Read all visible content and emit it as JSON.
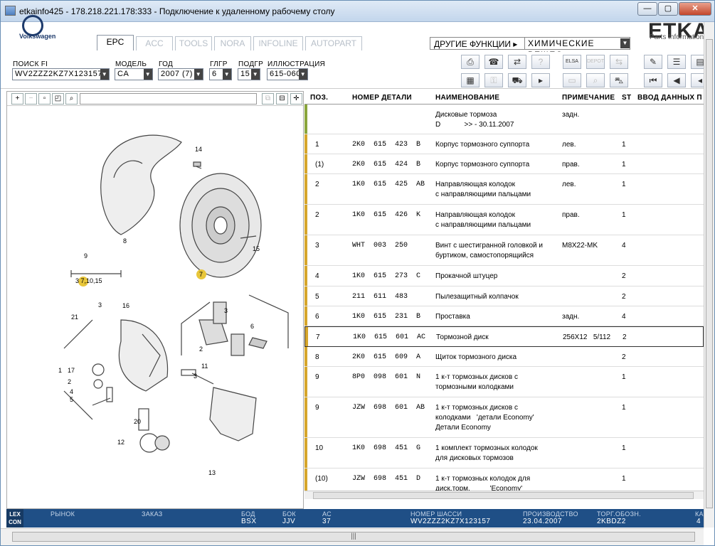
{
  "window": {
    "title": "etkainfo425 - 178.218.221.178:333 - Подключение к удаленному рабочему столу"
  },
  "brand": {
    "vw": "Volkswagen",
    "etka": "ETKA",
    "etka_sub": "Parts Information"
  },
  "tabs": [
    "EPC",
    "ACC",
    "TOOLS",
    "NORA",
    "INFOLINE",
    "AUTOPART"
  ],
  "other_functions": {
    "label": "ДРУГИЕ ФУНКЦИИ ▸",
    "value": "ХИМИЧЕСКИЕ ВЕЩЕС"
  },
  "filters": {
    "fi_label": "ПОИСК FI",
    "fi_value": "WV2ZZZ2KZ7X123157",
    "model_label": "МОДЕЛЬ",
    "model_value": "CA",
    "year_label": "ГОД",
    "year_value": "2007 (7)",
    "grp_label": "ГЛГР",
    "grp_value": "6",
    "sub_label": "ПОДГР",
    "sub_value": "15",
    "ill_label": "ИЛЛЮСТРАЦИЯ",
    "ill_value": "615-060"
  },
  "toolbar_icons": {
    "elsa": "ELSA",
    "depot": "DEPOT"
  },
  "table": {
    "headers": {
      "pos": "ПОЗ.",
      "pn": "НОМЕР ДЕТАЛИ",
      "name": "НАИМЕНОВАНИЕ",
      "note": "ПРИМЕЧАНИЕ",
      "st": "ST",
      "input": "ВВОД ДАННЫХ П"
    },
    "rows": [
      {
        "pos": "",
        "pn": "",
        "name": "Дисковые тормоза\nD            >> - 30.11.2007",
        "note": "задн.",
        "st": ""
      },
      {
        "pos": "1",
        "pn": "2K0  615  423  B",
        "name": "Корпус тормозного суппорта",
        "note": "лев.",
        "st": "1"
      },
      {
        "pos": "(1)",
        "pn": "2K0  615  424  B",
        "name": "Корпус тормозного суппорта",
        "note": "прав.",
        "st": "1"
      },
      {
        "pos": "2",
        "pn": "1K0  615  425  AB",
        "name": "Направляющая колодок\nс направляющими пальцами",
        "note": "лев.",
        "st": "1"
      },
      {
        "pos": "2",
        "pn": "1K0  615  426  K",
        "name": "Направляющая колодок\nс направляющими пальцами",
        "note": "прав.",
        "st": "1"
      },
      {
        "pos": "3",
        "pn": "WHT  003  250",
        "name": "Винт с шестигранной головкой и\nбуртиком, самостопорящийся",
        "note": "M8X22-MK",
        "st": "4"
      },
      {
        "pos": "4",
        "pn": "1K0  615  273  C",
        "name": "Прокачной штуцер",
        "note": "",
        "st": "2"
      },
      {
        "pos": "5",
        "pn": "211  611  483",
        "name": "Пылезащитный колпачок",
        "note": "",
        "st": "2"
      },
      {
        "pos": "6",
        "pn": "1K0  615  231  B",
        "name": "Проставка",
        "note": "задн.",
        "st": "4"
      },
      {
        "pos": "7",
        "pn": "1K0  615  601  AC",
        "name": "Тормозной диск",
        "note": "256X12   5/112",
        "st": "2"
      },
      {
        "pos": "8",
        "pn": "2K0  615  609  A",
        "name": "Щиток тормозного диска",
        "note": "",
        "st": "2"
      },
      {
        "pos": "9",
        "pn": "8P0  098  601  N",
        "name": "1 к-т тормозных дисков с\nтормозными колодками",
        "note": "",
        "st": "1"
      },
      {
        "pos": "9",
        "pn": "JZW  698  601  AB",
        "name": "1 к-т тормозных дисков с\nколодками   'детали Economy'\nДетали Economy",
        "note": "",
        "st": "1"
      },
      {
        "pos": "10",
        "pn": "1K0  698  451  G",
        "name": "1 комплект тормозных колодок\nдля дисковых тормозов",
        "note": "",
        "st": "1"
      },
      {
        "pos": "(10)",
        "pn": "JZW  698  451  D",
        "name": "1 к-т тормозных колодок для\nдиск.торм.          'Economy'",
        "note": "",
        "st": "1"
      }
    ]
  },
  "illustration": {
    "callouts": [
      "14",
      "8",
      "15",
      "7",
      "9",
      "3 7,10,15",
      "3",
      "16",
      "21",
      "1",
      "17",
      "2",
      "4",
      "5",
      "20",
      "12",
      "6",
      "3",
      "2",
      "3",
      "11",
      "13"
    ]
  },
  "status": {
    "lex": "LEX\nCON",
    "market_k": "РЫНОК",
    "market_v": "",
    "order_k": "ЗАКАЗ",
    "order_v": "",
    "bod_k": "БОД",
    "bod_v": "BSX",
    "bok_k": "БОК",
    "bok_v": "JJV",
    "ac_k": "АС",
    "ac_v": "37",
    "chassis_k": "НОМЕР ШАССИ",
    "chassis_v": "WV2ZZZ2KZ7X123157",
    "prod_k": "ПРОИЗВОДСТВО",
    "prod_v": "23.04.2007",
    "trade_k": "ТОРГ.ОБОЗН.",
    "trade_v": "2KBDZ2",
    "ka_k": "КА",
    "ka_v": "4"
  },
  "colors": {
    "accent": "#d6a62c",
    "status_bg": "#1f4f86",
    "group_marker": "#8aa53c"
  }
}
